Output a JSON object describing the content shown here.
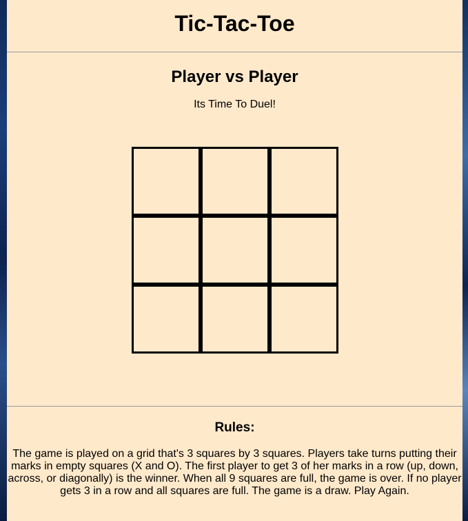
{
  "header": {
    "title": "Tic-Tac-Toe"
  },
  "game": {
    "mode": "Player vs Player",
    "tagline": "Its Time To Duel!",
    "board": [
      "",
      "",
      "",
      "",
      "",
      "",
      "",
      "",
      ""
    ]
  },
  "rules": {
    "title": "Rules:",
    "text": "The game is played on a grid that's 3 squares by 3 squares. Players take turns putting their marks in empty squares (X and O). The first player to get 3 of her marks in a row (up, down, across, or diagonally) is the winner. When all 9 squares are full, the game is over. If no player gets 3 in a row and all squares are full. The game is a draw. Play Again."
  },
  "colors": {
    "page_background": "#ffe9cb",
    "grid_lines": "#000000",
    "divider": "#9a9a9a"
  }
}
